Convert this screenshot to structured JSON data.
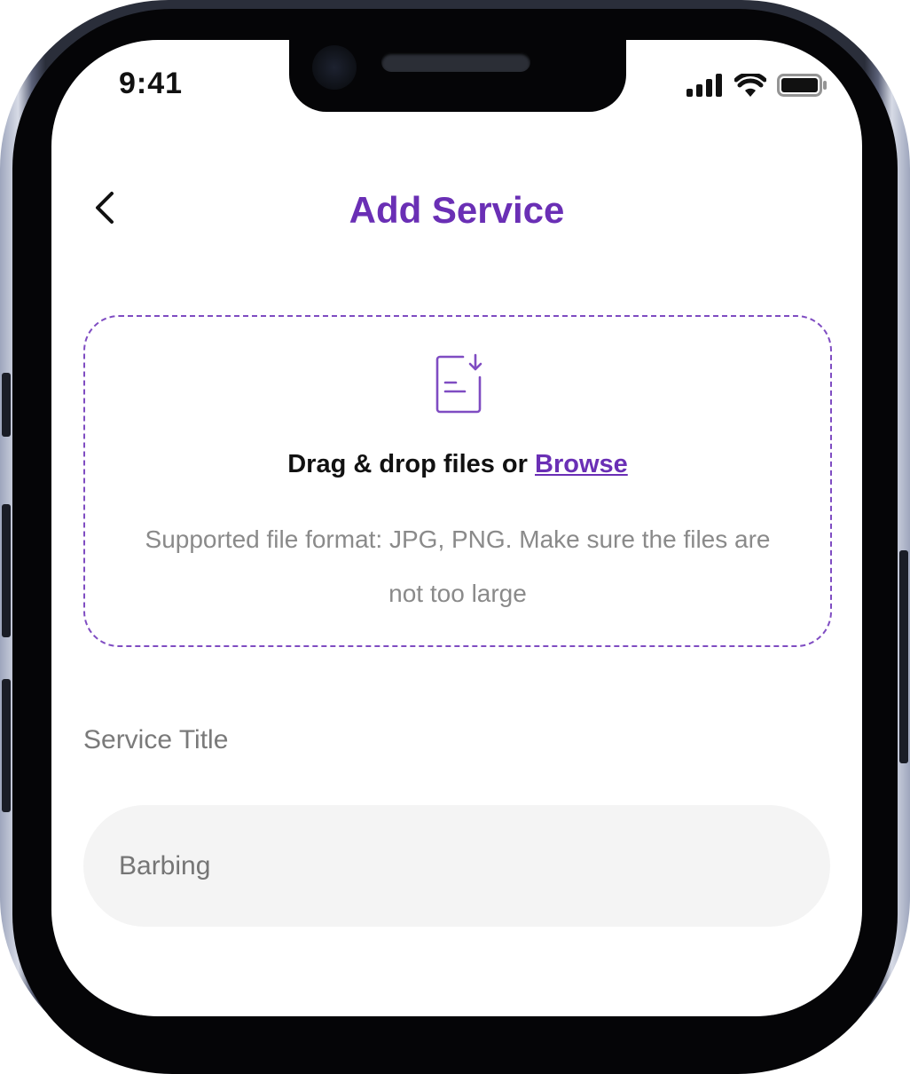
{
  "status_bar": {
    "time": "9:41"
  },
  "header": {
    "title": "Add Service"
  },
  "upload": {
    "prompt": "Drag & drop files or",
    "browse_label": "Browse",
    "hint": "Supported file format: JPG, PNG. Make sure the files are not too large"
  },
  "form": {
    "service_title_label": "Service Title",
    "service_title_value": "Barbing"
  },
  "colors": {
    "accent": "#6a2fb5",
    "muted_text": "#8a8a8a",
    "input_bg": "#f4f4f4"
  },
  "icons": [
    "back-chevron-icon",
    "file-download-icon",
    "signal-icon",
    "wifi-icon",
    "battery-icon"
  ]
}
